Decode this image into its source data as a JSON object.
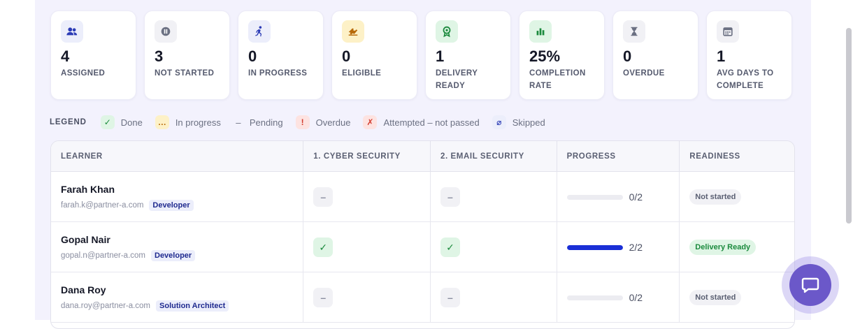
{
  "stats": [
    {
      "value": "4",
      "label": "ASSIGNED",
      "icon": "users-icon",
      "color": "#eceefb",
      "icon_color": "#2b3bb5"
    },
    {
      "value": "3",
      "label": "NOT STARTED",
      "icon": "pause-icon",
      "color": "#f1f1f5",
      "icon_color": "#6b7082"
    },
    {
      "value": "0",
      "label": "IN PROGRESS",
      "icon": "running-icon",
      "color": "#eceefb",
      "icon_color": "#2b3bb5"
    },
    {
      "value": "0",
      "label": "ELIGIBLE",
      "icon": "ticket-icon",
      "color": "#fdf1c7",
      "icon_color": "#b86a0a"
    },
    {
      "value": "1",
      "label": "DELIVERY READY",
      "icon": "badge-icon",
      "color": "#dff5e5",
      "icon_color": "#1b8a3d"
    },
    {
      "value": "25%",
      "label": "COMPLETION RATE",
      "icon": "bar-chart-icon",
      "color": "#dff5e5",
      "icon_color": "#1b8a3d"
    },
    {
      "value": "0",
      "label": "OVERDUE",
      "icon": "hourglass-icon",
      "color": "#f1f1f5",
      "icon_color": "#6b7082"
    },
    {
      "value": "1",
      "label": "AVG DAYS TO COMPLETE",
      "icon": "calendar-icon",
      "color": "#f1f1f5",
      "icon_color": "#6b7082"
    }
  ],
  "legend": {
    "title": "LEGEND",
    "items": [
      {
        "symbol": "✓",
        "label": "Done",
        "bg": "#dff5e5",
        "fg": "#1b8a3d"
      },
      {
        "symbol": "…",
        "label": "In progress",
        "bg": "#fdf1c7",
        "fg": "#b86a0a"
      },
      {
        "symbol": "–",
        "label": "Pending",
        "bg": "",
        "fg": "#6b7082"
      },
      {
        "symbol": "!",
        "label": "Overdue",
        "bg": "#fde3e1",
        "fg": "#d23b2e"
      },
      {
        "symbol": "✗",
        "label": "Attempted – not passed",
        "bg": "#fde3e1",
        "fg": "#d23b2e"
      },
      {
        "symbol": "⌀",
        "label": "Skipped",
        "bg": "#eceefb",
        "fg": "#2b3bb5"
      }
    ]
  },
  "table": {
    "headers": [
      "LEARNER",
      "1. CYBER SECURITY",
      "2. EMAIL SECURITY",
      "PROGRESS",
      "READINESS"
    ],
    "rows": [
      {
        "name": "Farah Khan",
        "email": "farah.k@partner-a.com",
        "role": "Developer",
        "cyber": "–",
        "cyber_status": "pending",
        "email_sec": "–",
        "email_status": "pending",
        "progress_text": "0/2",
        "progress": 0,
        "readiness": "Not started",
        "readiness_status": "not-started"
      },
      {
        "name": "Gopal Nair",
        "email": "gopal.n@partner-a.com",
        "role": "Developer",
        "cyber": "✓",
        "cyber_status": "done",
        "email_sec": "✓",
        "email_status": "done",
        "progress_text": "2/2",
        "progress": 1,
        "readiness": "Delivery Ready",
        "readiness_status": "ready"
      },
      {
        "name": "Dana Roy",
        "email": "dana.roy@partner-a.com",
        "role": "Solution Architect",
        "cyber": "–",
        "cyber_status": "pending",
        "email_sec": "–",
        "email_status": "pending",
        "progress_text": "0/2",
        "progress": 0,
        "readiness": "Not started",
        "readiness_status": "not-started"
      }
    ]
  },
  "chat": {
    "icon": "chat-bubble-icon",
    "color": "#6b58c9"
  }
}
